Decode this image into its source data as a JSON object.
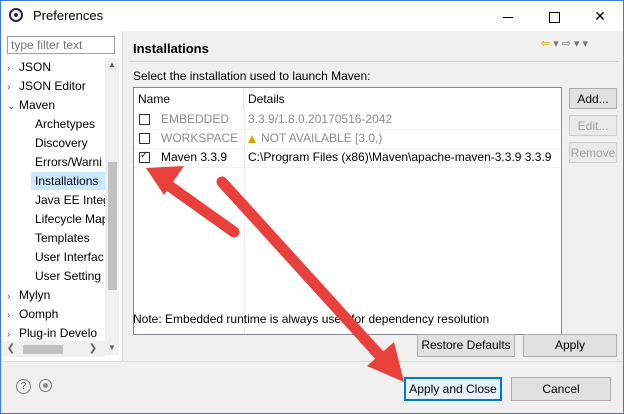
{
  "window": {
    "title": "Preferences"
  },
  "sidebar": {
    "filter_placeholder": "type filter text",
    "items": [
      {
        "label": "JSON",
        "arrow": "›"
      },
      {
        "label": "JSON Editor",
        "arrow": "›"
      },
      {
        "label": "Maven",
        "arrow": "⌄"
      },
      {
        "label": "Archetypes"
      },
      {
        "label": "Discovery"
      },
      {
        "label": "Errors/Warni"
      },
      {
        "label": "Installations"
      },
      {
        "label": "Java EE Integ"
      },
      {
        "label": "Lifecycle Map"
      },
      {
        "label": "Templates"
      },
      {
        "label": "User Interfac"
      },
      {
        "label": "User Setting"
      },
      {
        "label": "Mylyn",
        "arrow": "›"
      },
      {
        "label": "Oomph",
        "arrow": "›"
      },
      {
        "label": "Plug-in Develo",
        "arrow": "›"
      }
    ]
  },
  "page": {
    "title": "Installations",
    "instruction": "Select the installation used to launch Maven:",
    "table": {
      "headers": [
        "Name",
        "Details"
      ],
      "rows": [
        {
          "name": "EMBEDDED",
          "details": "3.3.9/1.8.0.20170516-2042",
          "checked": false,
          "disabled": true
        },
        {
          "name": "WORKSPACE",
          "details": "NOT AVAILABLE [3.0,)",
          "checked": false,
          "disabled": true,
          "warning": true
        },
        {
          "name": "Maven 3.3.9",
          "details": "C:\\Program Files (x86)\\Maven\\apache-maven-3.3.9 3.3.9",
          "checked": true,
          "disabled": false
        }
      ]
    },
    "buttons": {
      "add": "Add...",
      "edit": "Edit...",
      "remove": "Remove"
    },
    "note": "Note: Embedded runtime is always used for dependency resolution",
    "restore_defaults": "Restore Defaults",
    "apply": "Apply"
  },
  "footer": {
    "apply_and_close": "Apply and Close",
    "cancel": "Cancel"
  },
  "icons": {
    "help": "?",
    "min": "minimize-icon",
    "max": "maximize-icon",
    "close": "✕"
  },
  "colors": {
    "arrow": "#e8403a",
    "selection": "#cce8ff",
    "default_button_border": "#0078d7"
  }
}
